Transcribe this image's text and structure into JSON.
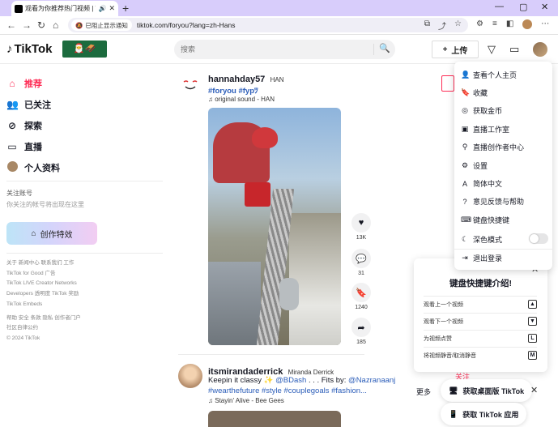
{
  "browser": {
    "tab_title": "观看为你推荐热门视频 | TikTok",
    "tab_sound_icon": "speaker-icon",
    "url": "tiktok.com/foryou?lang=zh-Hans",
    "notice_pill": "已阻止显示通知"
  },
  "header": {
    "logo": "TikTok",
    "search_placeholder": "搜索",
    "upload_label": "上传"
  },
  "sidebar": {
    "items": [
      {
        "label": "推荐",
        "icon": "home-icon"
      },
      {
        "label": "已关注",
        "icon": "following-icon"
      },
      {
        "label": "探索",
        "icon": "compass-icon"
      },
      {
        "label": "直播",
        "icon": "live-icon"
      },
      {
        "label": "个人资料",
        "icon": "avatar"
      }
    ],
    "following_title": "关注账号",
    "following_hint": "你关注的帐号将出现在这里",
    "effects_label": "创作特效",
    "footer_links": [
      "关于  新闻中心  联系我们  工作",
      "TikTok for Good  广告",
      "TikTok LIVE Creator Networks",
      "Developers  透明度  TikTok 奖励",
      "TikTok Embeds",
      "帮助  安全  条款  隐私  创作者门户",
      "社区自律公约",
      "© 2024 TikTok"
    ]
  },
  "posts": [
    {
      "username": "hannahday57",
      "nickname": "HAN",
      "caption": "#foryou #fyp",
      "music": "original sound - HAN",
      "likes": "13K",
      "comments": "31",
      "saves": "1240",
      "shares": "185"
    },
    {
      "username": "itsmirandaderrick",
      "nickname": "Miranda Derrick",
      "caption_text": "Keepin it classy",
      "caption_mention": "@BDash",
      "caption_mid": " . . . Fits by: ",
      "caption_mention2": "@Nazranaanj",
      "caption_tags": "#wearthefuture #style #couplegoals #fashion...",
      "music": "Stayin' Alive - Bee Gees"
    }
  ],
  "menu": {
    "items": [
      {
        "label": "查看个人主页",
        "icon": "user-icon"
      },
      {
        "label": "收藏",
        "icon": "bookmark-icon"
      },
      {
        "label": "获取金币",
        "icon": "coin-icon"
      },
      {
        "label": "直播工作室",
        "icon": "live-studio-icon"
      },
      {
        "label": "直播创作者中心",
        "icon": "creator-center-icon"
      },
      {
        "label": "设置",
        "icon": "gear-icon"
      },
      {
        "label": "简体中文",
        "icon": "language-icon"
      },
      {
        "label": "意见反馈与帮助",
        "icon": "help-icon"
      },
      {
        "label": "键盘快捷键",
        "icon": "keyboard-icon"
      },
      {
        "label": "深色模式",
        "icon": "moon-icon"
      }
    ],
    "logout": "退出登录"
  },
  "keyboard_panel": {
    "title": "键盘快捷键介绍!",
    "rows": [
      {
        "label": "观看上一个视频",
        "key": "▲"
      },
      {
        "label": "观看下一个视频",
        "key": "▼"
      },
      {
        "label": "为视频点赞",
        "key": "L"
      },
      {
        "label": "将视频静音/取消静音",
        "key": "M"
      }
    ]
  },
  "footer_right": {
    "more_label": "更多",
    "follow_label": "关注",
    "get_desktop": "获取桌面版 TikTok",
    "get_app": "获取 TikTok 应用"
  },
  "colors": {
    "accent": "#fe2c55",
    "tag": "#2b5db9",
    "tab_bar": "#d8cdfb"
  }
}
